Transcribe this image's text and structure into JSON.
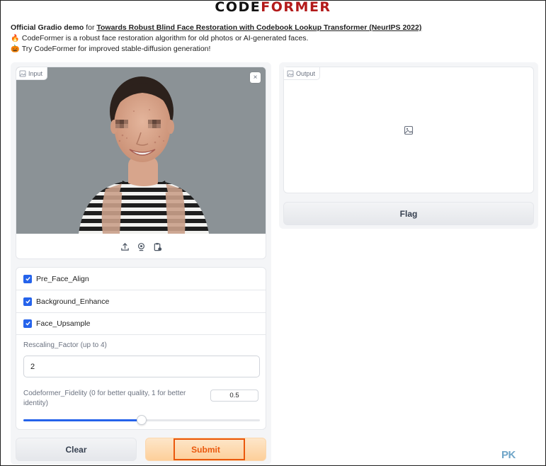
{
  "header": {
    "logo_part1": "CODE",
    "logo_part2": "FORMER",
    "intro_lead": "Official Gradio demo",
    "intro_for": " for ",
    "intro_link": "Towards Robust Blind Face Restoration with Codebook Lookup Transformer (NeurIPS 2022)",
    "line2": "CodeFormer is a robust face restoration algorithm for old photos or AI-generated faces.",
    "line3": "Try CodeFormer for improved stable-diffusion generation!"
  },
  "input_panel": {
    "label": "Input",
    "close": "×"
  },
  "output_panel": {
    "label": "Output"
  },
  "buttons": {
    "flag": "Flag",
    "clear": "Clear",
    "submit": "Submit"
  },
  "options": {
    "checkboxes": [
      {
        "label": "Pre_Face_Align",
        "checked": true
      },
      {
        "label": "Background_Enhance",
        "checked": true
      },
      {
        "label": "Face_Upsample",
        "checked": true
      }
    ],
    "rescaling_label": "Rescaling_Factor (up to 4)",
    "rescaling_value": "2",
    "fidelity_label_1": "Codeformer_Fidelity (0 for better quality, 1 for better",
    "fidelity_label_2": "identity)",
    "fidelity_value": "0.5",
    "fidelity_slider_fraction": 0.5
  },
  "watermark": "PK",
  "colors": {
    "accent_blue": "#2563eb",
    "submit_orange": "#ea580c",
    "logo_red": "#b31a1a"
  }
}
